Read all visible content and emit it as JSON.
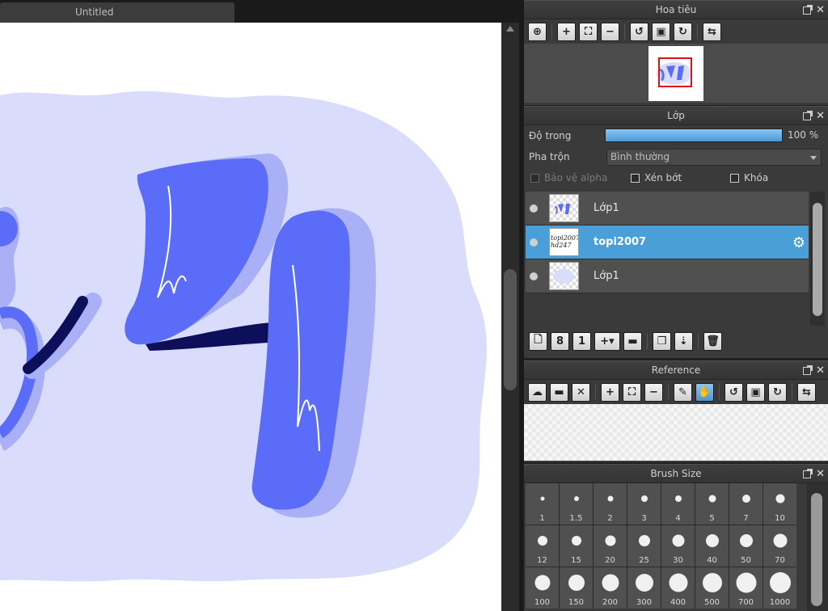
{
  "document": {
    "tab_title": "Untitled"
  },
  "navigator": {
    "title": "Hoa tiêu"
  },
  "layers": {
    "title": "Lớp",
    "opacity_label": "Độ trong",
    "opacity_value": "100 %",
    "opacity_fraction": 1.0,
    "blend_label": "Pha trộn",
    "blend_value": "Bình thường",
    "protect_alpha_label": "Bảo vệ alpha",
    "clipping_label": "Xén bớt",
    "lock_label": "Khóa",
    "items": [
      {
        "name": "Lớp1",
        "selected": false
      },
      {
        "name": "topi2007",
        "selected": true,
        "thumb_text": "topi2007 hd247"
      },
      {
        "name": "Lớp1",
        "selected": false
      }
    ]
  },
  "reference": {
    "title": "Reference"
  },
  "brush_size": {
    "title": "Brush Size",
    "sizes": [
      "1",
      "1.5",
      "2",
      "3",
      "4",
      "5",
      "7",
      "10",
      "12",
      "15",
      "20",
      "25",
      "30",
      "40",
      "50",
      "70",
      "100",
      "150",
      "200",
      "300",
      "400",
      "500",
      "700",
      "1000"
    ]
  },
  "colors": {
    "accent": "#4a9fd8",
    "shape_main": "#5b6cf8",
    "shape_shadow": "#a9b0f6",
    "blob": "#d9dcfb",
    "stroke_dark": "#0d0f5a"
  },
  "icons": {
    "navigator_toolbar": [
      "zoom-fit-icon",
      "zoom-in-icon",
      "fit-window-icon",
      "zoom-out-icon",
      "rotate-left-icon",
      "reset-rotation-icon",
      "rotate-right-icon",
      "flip-horizontal-icon"
    ],
    "layer_toolbar": [
      "new-layer-icon",
      "new-8bit-layer-icon",
      "new-1bit-layer-icon",
      "add-layer-menu-icon",
      "new-folder-icon",
      "duplicate-layer-icon",
      "merge-down-icon",
      "delete-layer-icon"
    ],
    "reference_toolbar": [
      "upload-icon",
      "open-folder-icon",
      "close-icon",
      "zoom-in-icon",
      "fit-window-icon",
      "zoom-out-icon",
      "eyedropper-icon",
      "hand-icon",
      "rotate-left-icon",
      "reset-rotation-icon",
      "rotate-right-icon",
      "flip-horizontal-icon"
    ]
  }
}
